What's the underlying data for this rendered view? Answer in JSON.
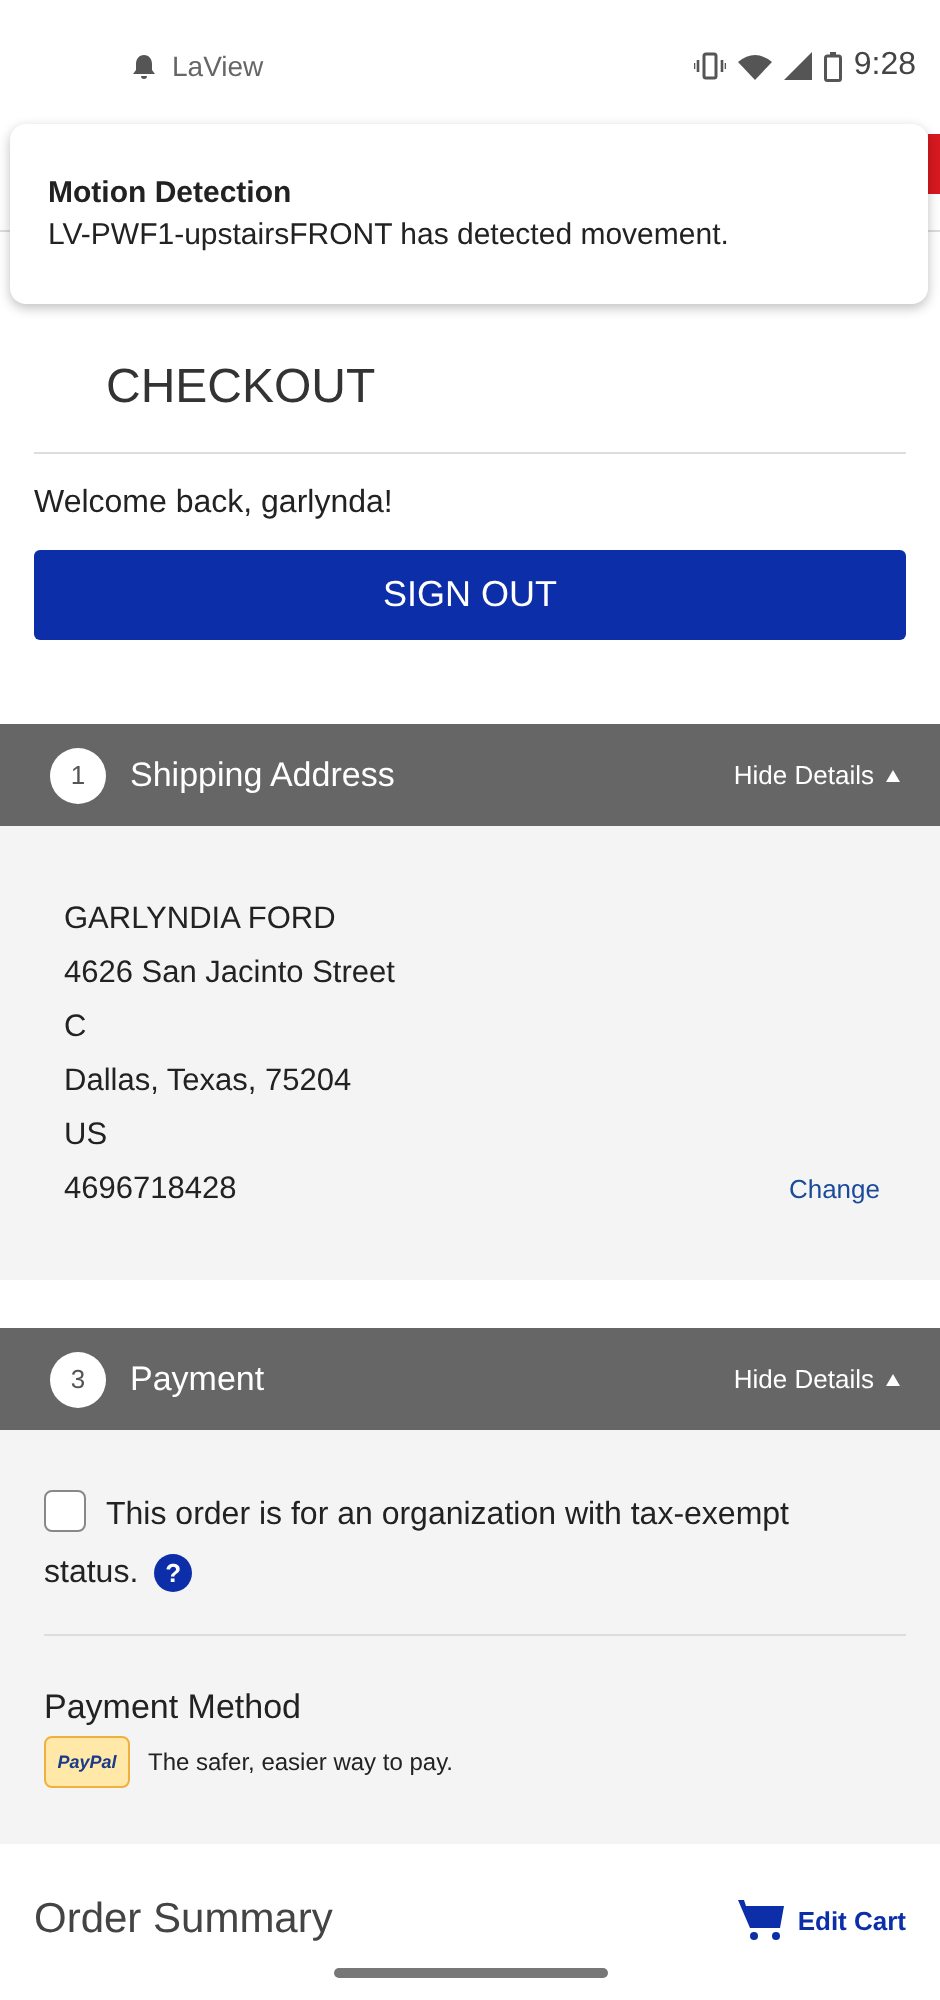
{
  "status_bar": {
    "app": "LaView",
    "time": "9:28"
  },
  "notification": {
    "title": "Motion Detection",
    "body": "LV-PWF1-upstairsFRONT has detected movement."
  },
  "page": {
    "title": "CHECKOUT",
    "welcome": "Welcome back, garlynda!",
    "sign_out": "SIGN OUT"
  },
  "sections": [
    {
      "kind": "address",
      "step": "1",
      "title": "Shipping Address",
      "toggle": "Hide Details",
      "expanded": true,
      "lines": [
        "GARLYNDIA FORD",
        "4626 San Jacinto Street",
        "C",
        "Dallas, Texas, 75204",
        "US",
        "4696718428"
      ],
      "action": "Change"
    },
    {
      "kind": "payment",
      "step": "3",
      "title": "Payment",
      "toggle": "Hide Details",
      "expanded": true,
      "tax_exempt": {
        "label": "This order is for an organization with tax-exempt status.",
        "checked": false,
        "help": "?"
      },
      "method_label": "Payment Method",
      "paypal_logo": "PayPal",
      "paypal_text": "The safer, easier way to pay."
    }
  ],
  "order_summary": {
    "title": "Order Summary",
    "edit": "Edit Cart"
  }
}
